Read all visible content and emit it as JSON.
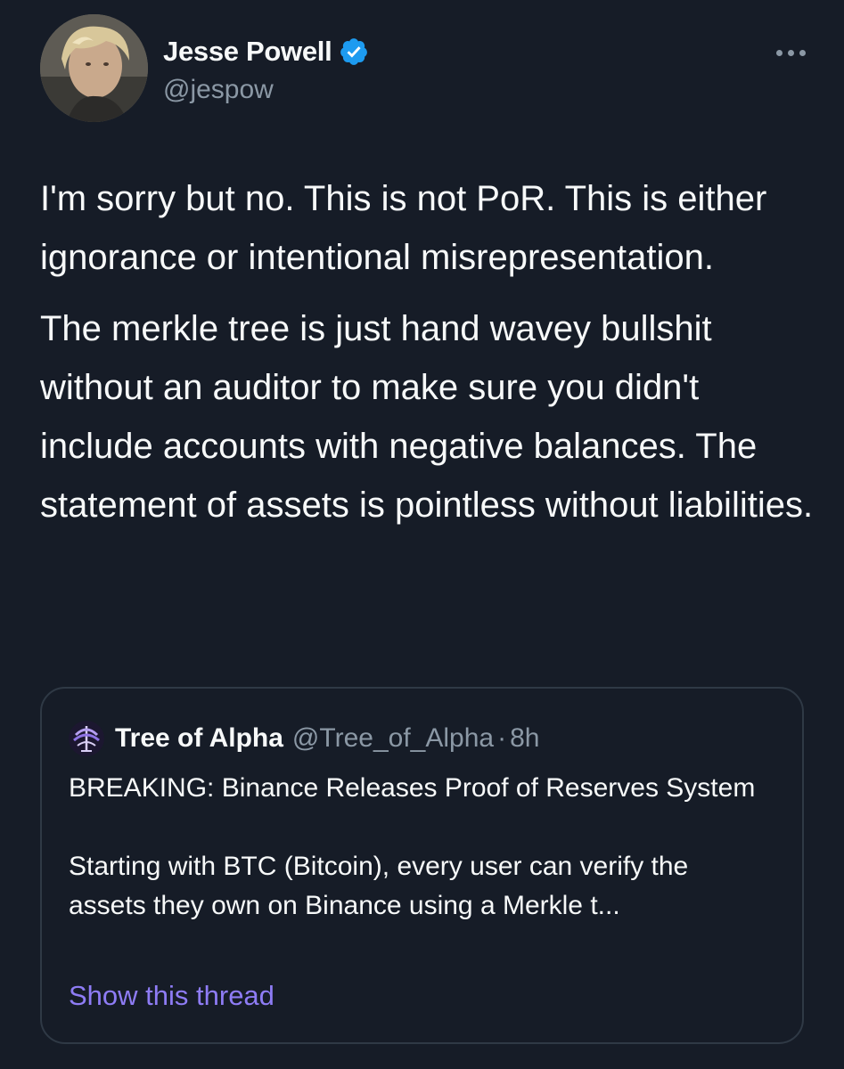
{
  "author": {
    "name": "Jesse Powell",
    "handle": "@jespow",
    "avatar_icon": "profile-photo",
    "verified_icon": "verified-badge-icon",
    "verified_color": "#1d9bf0"
  },
  "more_icon": "more-horizontal-icon",
  "body": {
    "paragraphs": [
      "I'm sorry but no. This is not PoR. This is either ignorance or intentional misrepresentation.",
      "The merkle tree is just hand wavey bullshit without an auditor to make sure you didn't include accounts with negative balances. The statement of assets is pointless without liabilities."
    ]
  },
  "quote": {
    "name": "Tree of Alpha",
    "handle": "@Tree_of_Alpha",
    "separator": "·",
    "time": "8h",
    "avatar_icon": "tree-of-alpha-logo",
    "paragraphs": [
      "BREAKING: Binance Releases Proof of Reserves System",
      "Starting with BTC (Bitcoin), every user can verify the assets they own on Binance using a Merkle t..."
    ],
    "show_thread": "Show this thread"
  },
  "colors": {
    "background": "#161c27",
    "text": "#f7f9f9",
    "secondary": "#8b98a5",
    "link": "#8e7cf5",
    "border": "#2f3945"
  }
}
